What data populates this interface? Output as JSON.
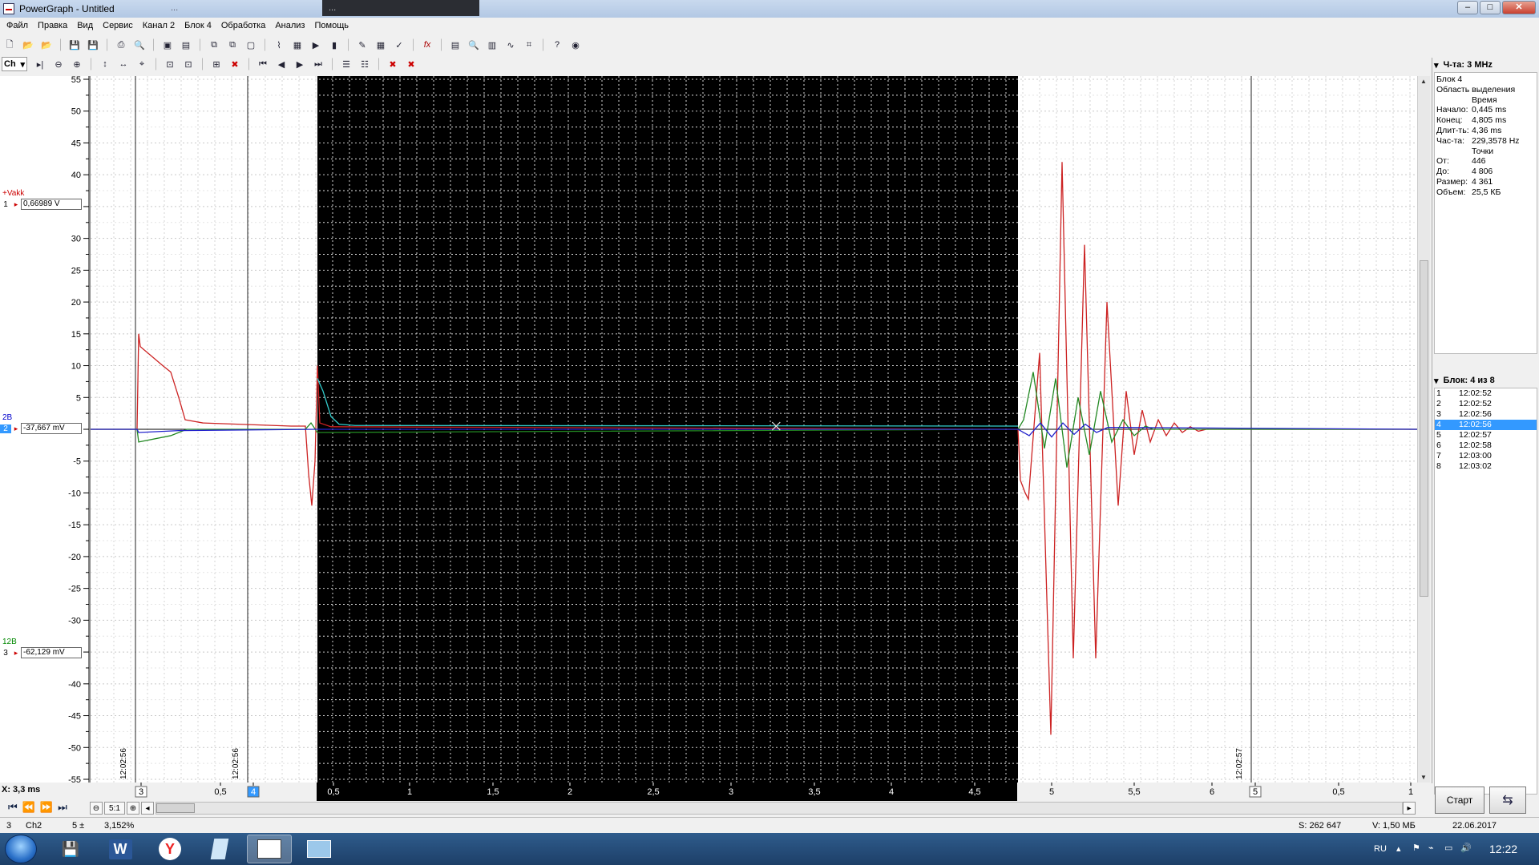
{
  "window": {
    "title": "PowerGraph - Untitled",
    "ghost_tab_1": "...",
    "ghost_tab_2": "..."
  },
  "menu": [
    "Файл",
    "Правка",
    "Вид",
    "Сервис",
    "Канал 2",
    "Блок 4",
    "Обработка",
    "Анализ",
    "Помощь"
  ],
  "toolbar2": {
    "channel_select": "Ch"
  },
  "channels": [
    {
      "num": "1",
      "label": "+Vakk",
      "value": "0,66989 V",
      "color": "#cc0000"
    },
    {
      "num": "2",
      "label": "2B",
      "value": "-37,667 mV",
      "color": "#0000cc"
    },
    {
      "num": "3",
      "label": "12B",
      "value": "-62,129 mV",
      "color": "#008800"
    }
  ],
  "side_panel": {
    "freq_label": "Ч-та: 3 MHz",
    "info": {
      "block": "Блок 4",
      "selection_title": "Область выделения",
      "time_title": "Время",
      "start_k": "Начало:",
      "start_v": "0,445 ms",
      "end_k": "Конец:",
      "end_v": "4,805 ms",
      "dur_k": "Длит-ть:",
      "dur_v": "4,36 ms",
      "freq_k": "Час-та:",
      "freq_v": "229,3578 Hz",
      "points_title": "Точки",
      "from_k": "От:",
      "from_v": "446",
      "to_k": "До:",
      "to_v": "4 806",
      "size_k": "Размер:",
      "size_v": "4 361",
      "vol_k": "Объем:",
      "vol_v": "25,5 КБ"
    },
    "block_label": "Блок: 4 из 8",
    "blocks": [
      {
        "n": "1",
        "t": "12:02:52"
      },
      {
        "n": "2",
        "t": "12:02:52"
      },
      {
        "n": "3",
        "t": "12:02:56"
      },
      {
        "n": "4",
        "t": "12:02:56"
      },
      {
        "n": "5",
        "t": "12:02:57"
      },
      {
        "n": "6",
        "t": "12:02:58"
      },
      {
        "n": "7",
        "t": "12:03:00"
      },
      {
        "n": "8",
        "t": "12:03:02"
      }
    ],
    "selected_block": 3,
    "start_button": "Старт"
  },
  "x_readout": "X: 3,3 ms",
  "zoom_ratio": "5:1",
  "status": {
    "s1": "3",
    "s2": "Ch2",
    "s3": "5 ±",
    "s4": "3,152%",
    "s5": "S: 262 647",
    "s6": "V: 1,50 МБ",
    "s7": "22.06.2017"
  },
  "tray": {
    "lang": "RU",
    "time": "12:22"
  },
  "chart_data": {
    "type": "line",
    "y_ticks": [
      "55",
      "50",
      "45",
      "40",
      "35",
      "30",
      "25",
      "20",
      "15",
      "10",
      "5",
      "0",
      "-5",
      "-10",
      "-15",
      "-20",
      "-25",
      "-30",
      "-35",
      "-40",
      "-45",
      "-50",
      "-55"
    ],
    "ylim": [
      -55,
      55
    ],
    "x_ticks": [
      "3",
      "0,5",
      "4",
      "0,5",
      "1",
      "1,5",
      "2",
      "2,5",
      "3",
      "3,5",
      "4",
      "4,5",
      "5",
      "5,5",
      "6",
      "5",
      "0,5",
      "1"
    ],
    "block_timestamps": [
      "12:02:56",
      "12:02:56",
      "12:02:57"
    ],
    "selection": {
      "start_ms": 0.445,
      "end_ms": 4.805
    },
    "grid": true,
    "series": [
      {
        "color": "#cc2222"
      },
      {
        "color": "#2222cc"
      },
      {
        "color": "#228822"
      },
      {
        "color": "#33cccc"
      }
    ]
  }
}
